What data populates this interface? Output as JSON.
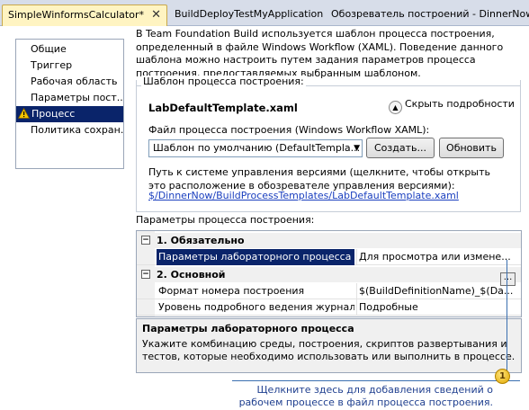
{
  "tabs": [
    {
      "label": "SimpleWinformsCalculator*",
      "active": true
    },
    {
      "label": "BuildDeployTestMyApplication",
      "active": false
    },
    {
      "label": "Обозреватель построений - DinnerNow",
      "active": false
    }
  ],
  "tab_close": "✕",
  "nav": {
    "items": [
      {
        "label": "Общие"
      },
      {
        "label": "Триггер"
      },
      {
        "label": "Рабочая область"
      },
      {
        "label": "Параметры пост..."
      },
      {
        "label": "Процесс",
        "selected": true,
        "icon": "warning-icon"
      },
      {
        "label": "Политика сохран..."
      }
    ]
  },
  "intro": "В Team Foundation Build используется шаблон процесса построения, определенный в файле Windows Workflow (XAML). Поведение данного шаблона можно настроить путем задания параметров процесса построения, предоставляемых выбранным шаблоном.",
  "template_group": {
    "legend": "Шаблон процесса построения:",
    "template_name": "LabDefaultTemplate.xaml",
    "hide_details": "Скрыть подробности",
    "hide_details_glyph": "▲",
    "file_label": "Файл процесса построения (Windows Workflow XAML):",
    "combo_value": "Шаблон по умолчанию (DefaultTempla...",
    "combo_arrow": "▼",
    "create_button": "Создать...",
    "refresh_button": "Обновить",
    "path_label": "Путь к системе управления версиями (щелкните, чтобы открыть это расположение в обозревателе управления версиями):",
    "path_link": "$/DinnerNow/BuildProcessTemplates/LabDefaultTemplate.xaml"
  },
  "params": {
    "title": "Параметры процесса построения:",
    "sections": [
      {
        "label": "1. Обязательно",
        "expander": "⊟",
        "rows": [
          {
            "name": "Параметры лабораторного процесса",
            "value": "Для просмотра или измене...",
            "selected": true,
            "warning": true
          }
        ]
      },
      {
        "label": "2. Основной",
        "expander": "⊟",
        "rows": [
          {
            "name": "Формат номера построения",
            "value": "$(BuildDefinitionName)_$(Da..."
          },
          {
            "name": "Уровень подробного ведения журнала",
            "value": "Подробные"
          }
        ]
      }
    ],
    "ellipsis": "..."
  },
  "description": {
    "title": "Параметры лабораторного процесса",
    "text": "Укажите комбинацию среды, построения, скриптов развертывания и тестов, которые необходимо использовать или выполнить в процессе."
  },
  "callout": {
    "number": "1",
    "text": "Щелкните здесь для добавления сведений о рабочем процессе в файл процесса построения."
  },
  "colors": {
    "selection": "#0a246a",
    "link": "#1a3fbf",
    "callout": "#1f3f8f",
    "active_tab": "#fff4c2"
  }
}
